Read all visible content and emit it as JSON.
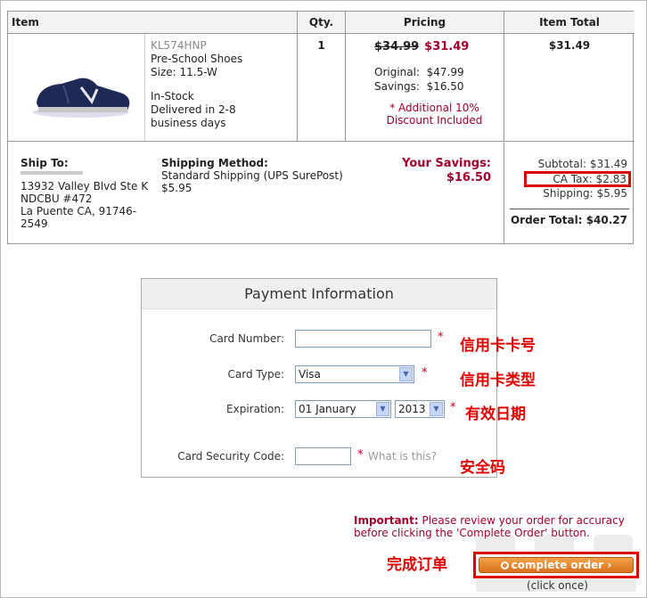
{
  "table": {
    "headers": {
      "item": "Item",
      "qty": "Qty.",
      "pricing": "Pricing",
      "total": "Item Total"
    },
    "item": {
      "image_alt": "shoe-image",
      "sku": "KL574HNP",
      "name": "Pre-School Shoes",
      "size": "Size: 11.5-W",
      "stock": "In-Stock",
      "delivery": "Delivered in 2-8 business days"
    },
    "qty": "1",
    "pricing": {
      "old_price": "$34.99",
      "sale_price": "$31.49",
      "original_label": "Original:",
      "original_value": "$47.99",
      "savings_label": "Savings:",
      "savings_value": "$16.50",
      "note_line1": "* Additional 10%",
      "note_line2": "Discount Included"
    },
    "item_total": "$31.49"
  },
  "shipping": {
    "ship_to_label": "Ship To:",
    "address_line1": "13932 Valley Blvd Ste K",
    "address_line2": "NDCBU #472",
    "address_line3": "La Puente CA, 91746-",
    "address_line4": "2549",
    "method_label": "Shipping Method:",
    "method_value": "Standard Shipping (UPS SurePost)",
    "method_price": "$5.95",
    "your_savings_label": "Your Savings:",
    "your_savings_value": "$16.50"
  },
  "summary": {
    "subtotal_label": "Subtotal:",
    "subtotal_value": "$31.49",
    "tax_label": "CA Tax:",
    "tax_value": "$2.83",
    "shipping_label": "Shipping:",
    "shipping_value": "$5.95",
    "order_total_label": "Order Total:",
    "order_total_value": "$40.27"
  },
  "payment": {
    "title": "Payment Information",
    "card_number_label": "Card Number:",
    "card_number_value": "",
    "card_type_label": "Card Type:",
    "card_type_value": "Visa",
    "expiration_label": "Expiration:",
    "exp_month_value": "01 January",
    "exp_year_value": "2013",
    "csc_label": "Card Security Code:",
    "csc_value": "",
    "required_mark": "*",
    "what_is_this": "What is this?"
  },
  "annotations": {
    "card_number": "信用卡卡号",
    "card_type": "信用卡类型",
    "expiration": "有效日期",
    "csc": "安全码",
    "complete": "完成订单"
  },
  "footer": {
    "important_label": "Important:",
    "important_text": "Please review your order for accuracy before clicking the 'Complete Order' button.",
    "complete_button": "complete order",
    "click_once": "(click once)"
  },
  "colors": {
    "accent_red": "#a0002a",
    "highlight_red": "#e00000",
    "button_orange": "#d9701c"
  }
}
